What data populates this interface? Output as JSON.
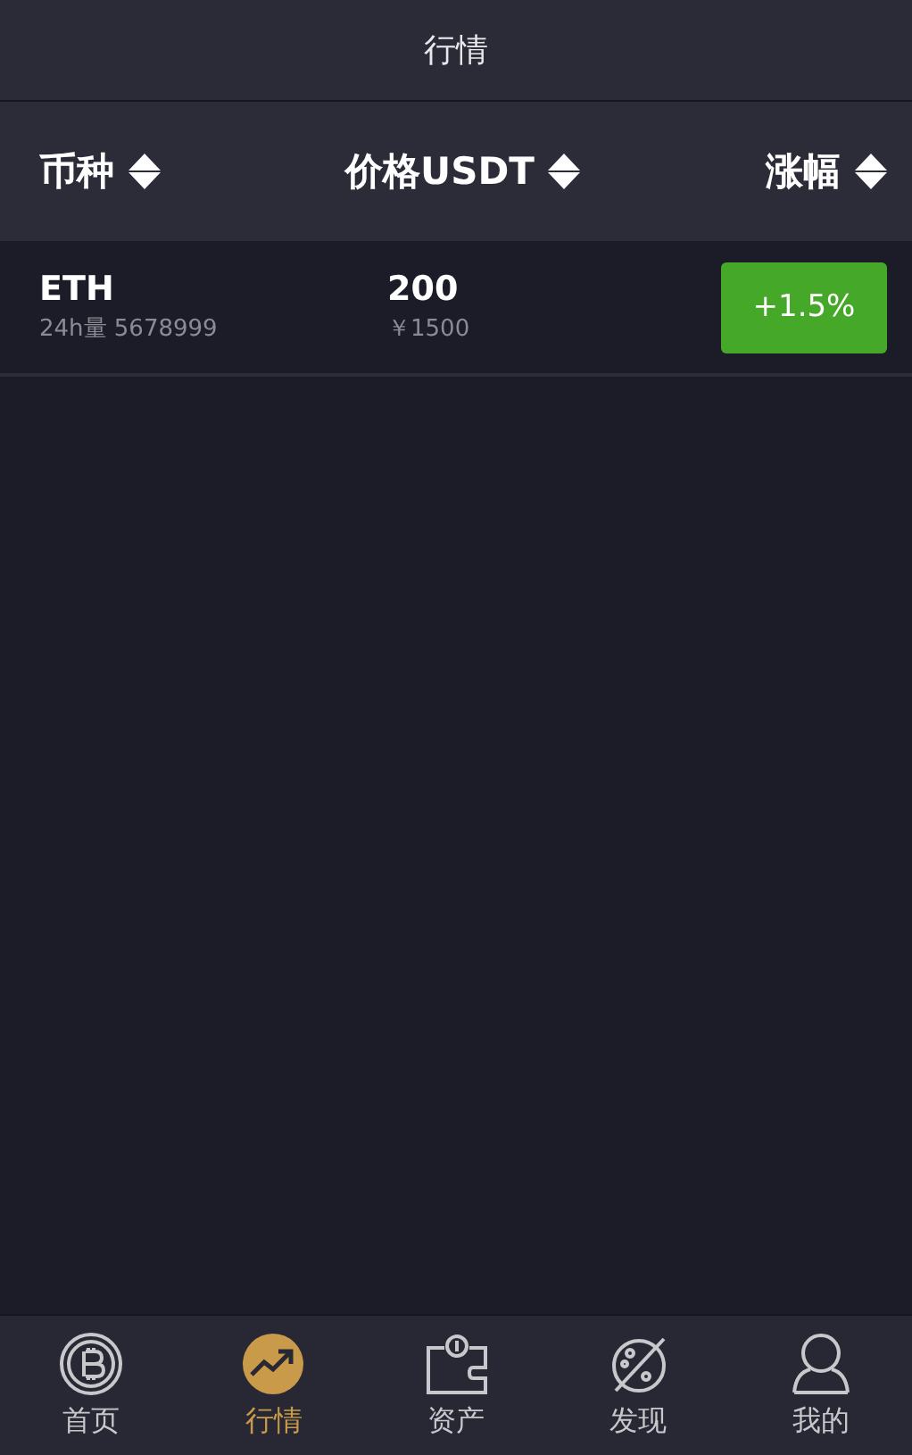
{
  "header": {
    "title": "行情"
  },
  "columns": [
    {
      "label": "币种"
    },
    {
      "label": "价格USDT"
    },
    {
      "label": "涨幅"
    }
  ],
  "rows": [
    {
      "symbol": "ETH",
      "volume": "24h量 5678999",
      "price": "200",
      "cny": "￥1500",
      "change": "+1.5%",
      "color": "#45a828"
    }
  ],
  "tabs": [
    {
      "label": "首页",
      "kind": "coin",
      "selected": false
    },
    {
      "label": "行情",
      "kind": "chart",
      "selected": true
    },
    {
      "label": "资产",
      "kind": "wallet",
      "selected": false
    },
    {
      "label": "发现",
      "kind": "planet",
      "selected": false
    },
    {
      "label": "我的",
      "kind": "user",
      "selected": false
    }
  ]
}
